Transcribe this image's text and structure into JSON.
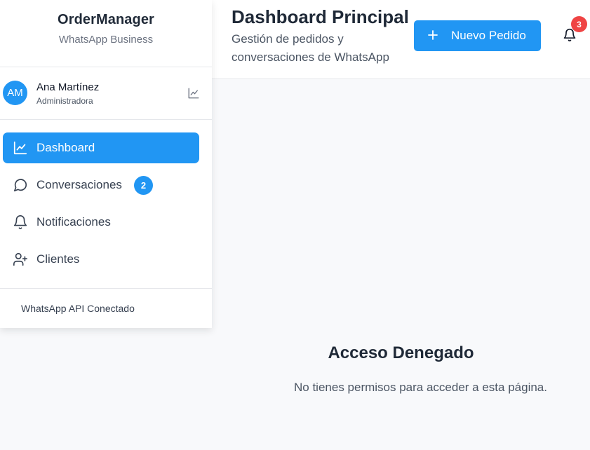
{
  "sidebar": {
    "brand_title": "OrderManager",
    "brand_subtitle": "WhatsApp Business",
    "user": {
      "initials": "AM",
      "name": "Ana Martínez",
      "role": "Administradora",
      "icon": "chart-line-icon"
    },
    "items": [
      {
        "label": "Dashboard",
        "icon": "chart-line-icon",
        "active": true
      },
      {
        "label": "Conversaciones",
        "icon": "chat-bubble-icon",
        "badge": "2"
      },
      {
        "label": "Notificaciones",
        "icon": "bell-icon"
      },
      {
        "label": "Clientes",
        "icon": "user-plus-icon"
      }
    ],
    "footer": "WhatsApp API Conectado"
  },
  "header": {
    "title": "Dashboard Principal",
    "subtitle": "Gestión de pedidos y conversaciones de WhatsApp",
    "new_button": "Nuevo Pedido",
    "notification_count": "3"
  },
  "main": {
    "title": "Acceso Denegado",
    "message": "No tienes permisos para acceder a esta página."
  },
  "colors": {
    "accent": "#2196f3",
    "danger_badge": "#ef4444",
    "background": "#f8f9fb"
  }
}
